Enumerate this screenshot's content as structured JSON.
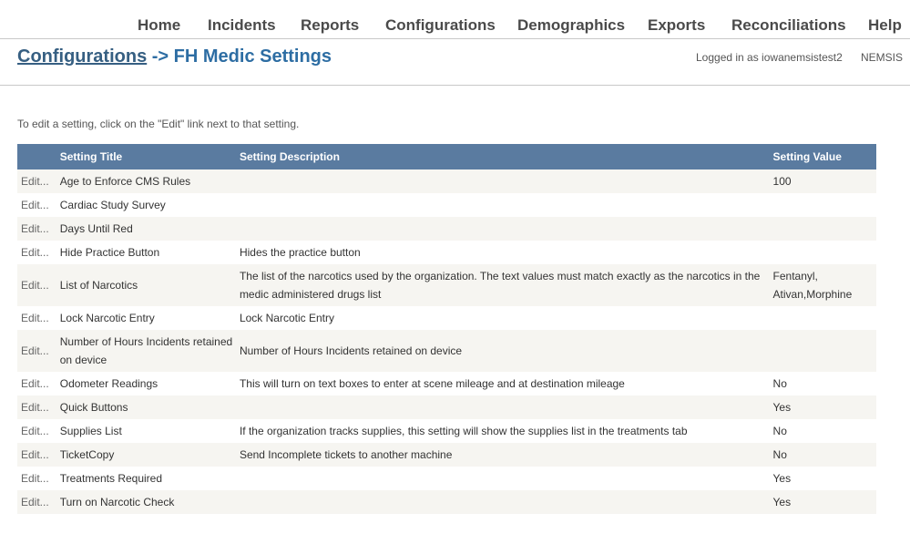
{
  "nav": {
    "home": "Home",
    "incidents": "Incidents",
    "reports": "Reports",
    "configurations": "Configurations",
    "demographics": "Demographics",
    "exports": "Exports",
    "reconciliations": "Reconciliations",
    "help": "Help"
  },
  "header": {
    "breadcrumb_link": "Configurations",
    "breadcrumb_sep": " -> ",
    "page_title": "FH Medic Settings",
    "logged_in": "Logged in as iowanemsistest2",
    "nemsis": "NEMSIS"
  },
  "instructions": "To edit a setting, click on the \"Edit\" link next to that setting.",
  "table": {
    "headers": {
      "edit": "",
      "title": "Setting Title",
      "description": "Setting Description",
      "value": "Setting Value"
    },
    "edit_label": "Edit...",
    "rows": [
      {
        "title": "Age to Enforce CMS Rules",
        "description": "",
        "value": "100"
      },
      {
        "title": "Cardiac Study Survey",
        "description": "",
        "value": ""
      },
      {
        "title": "Days Until Red",
        "description": "",
        "value": ""
      },
      {
        "title": "Hide Practice Button",
        "description": "Hides the practice button",
        "value": ""
      },
      {
        "title": "List of Narcotics",
        "description": "The list of the narcotics used by the organization. The text values must match exactly as the narcotics in the medic administered drugs list",
        "value": "Fentanyl, Ativan,Morphine"
      },
      {
        "title": "Lock Narcotic Entry",
        "description": "Lock Narcotic Entry",
        "value": ""
      },
      {
        "title": "Number of Hours Incidents retained on device",
        "description": "Number of Hours Incidents retained on device",
        "value": ""
      },
      {
        "title": "Odometer Readings",
        "description": "This will turn on text boxes to enter at scene mileage and at destination mileage",
        "value": "No"
      },
      {
        "title": "Quick Buttons",
        "description": "",
        "value": "Yes"
      },
      {
        "title": "Supplies List",
        "description": "If the organization tracks supplies, this setting will show the supplies list in the treatments tab",
        "value": "No"
      },
      {
        "title": "TicketCopy",
        "description": "Send Incomplete tickets to another machine",
        "value": "No"
      },
      {
        "title": "Treatments Required",
        "description": "",
        "value": "Yes"
      },
      {
        "title": "Turn on Narcotic Check",
        "description": "",
        "value": "Yes"
      }
    ]
  }
}
